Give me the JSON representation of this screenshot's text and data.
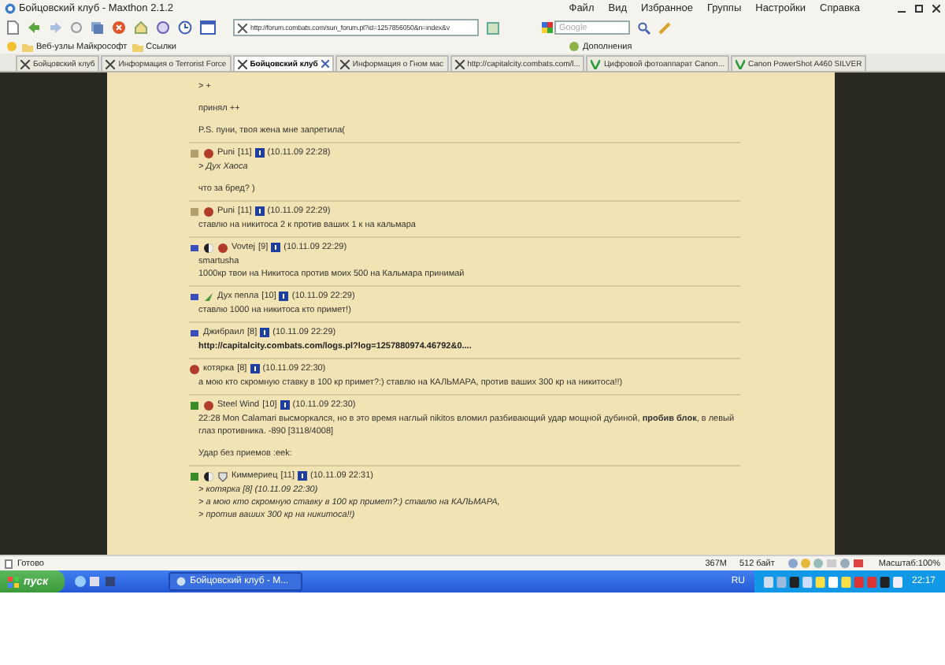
{
  "window": {
    "title": "Бойцовский клуб - Maxthon 2.1.2"
  },
  "menu": [
    "Файл",
    "Вид",
    "Избранное",
    "Группы",
    "Настройки",
    "Справка"
  ],
  "toolbar": {
    "address": "http://forum.combats.com/sun_forum.pl?id=1257856050&n=index&v",
    "search": {
      "placeholder": "Google"
    }
  },
  "links_bar": {
    "items": [
      "Веб-узлы Майкрософт",
      "Ссылки"
    ],
    "addons": "Дополнения"
  },
  "tabs": [
    {
      "label": "Бойцовский клуб",
      "selected": false
    },
    {
      "label": "Информация о Terrorist Force",
      "selected": false
    },
    {
      "label": "Бойцовский клуб",
      "selected": true
    },
    {
      "label": "Информация о Гном мас",
      "selected": false
    },
    {
      "label": "http://capitalcity.combats.com/l...",
      "selected": false
    },
    {
      "label": "Цифровой фотоаппарат Canon...",
      "selected": false
    },
    {
      "label": "Canon PowerShot A460 SILVER",
      "selected": false
    }
  ],
  "posts": [
    {
      "paragraphs": [
        [
          {
            "kind": "text",
            "text": "> +"
          }
        ],
        [
          {
            "kind": "text",
            "text": "принял ++"
          }
        ],
        [
          {
            "kind": "text",
            "text": "P.S. пуни, твоя жена мне запретила("
          }
        ]
      ]
    },
    {
      "author": "Puni",
      "level": "[11]",
      "time": "(10.11.09 22:28)",
      "icons": [
        {
          "kind": "badge"
        },
        {
          "kind": "orb"
        }
      ],
      "paragraphs": [
        [
          {
            "kind": "quote",
            "text": "> Дух Хаоса"
          }
        ],
        [
          {
            "kind": "text",
            "text": "что за бред? )"
          }
        ]
      ]
    },
    {
      "author": "Puni",
      "level": "[11]",
      "time": "(10.11.09 22:29)",
      "icons": [
        {
          "kind": "badge"
        },
        {
          "kind": "orb"
        }
      ],
      "paragraphs": [
        [
          {
            "kind": "text",
            "text": "ставлю на никитоса 2 к против ваших 1 к на кальмара"
          }
        ]
      ]
    },
    {
      "author": "Vovtej",
      "level": "[9]",
      "time": "(10.11.09 22:29)",
      "icons": [
        {
          "kind": "square"
        },
        {
          "kind": "yin"
        },
        {
          "kind": "orb"
        }
      ],
      "paragraphs": [
        [
          {
            "kind": "text",
            "text": "smartusha"
          },
          {
            "kind": "text",
            "text": "1000кр твои на Никитоса против моих 500 на Кальмара принимай"
          }
        ]
      ]
    },
    {
      "author": "Дух пепла",
      "level": "[10]",
      "time": "(10.11.09 22:29)",
      "icons": [
        {
          "kind": "square"
        },
        {
          "kind": "leaf"
        }
      ],
      "paragraphs": [
        [
          {
            "kind": "text",
            "text": "ставлю 1000 на никитоса кто примет!)"
          }
        ]
      ]
    },
    {
      "author": "Джибраил",
      "level": "[8]",
      "time": "(10.11.09 22:29)",
      "icons": [
        {
          "kind": "square"
        }
      ],
      "paragraphs": [
        [
          {
            "kind": "link",
            "text": "http://capitalcity.combats.com/logs.pl?log=1257880974.46792&0...."
          }
        ]
      ]
    },
    {
      "author": "котярка",
      "level": "[8]",
      "time": "(10.11.09 22:30)",
      "icons": [
        {
          "kind": "orb"
        }
      ],
      "paragraphs": [
        [
          {
            "kind": "text",
            "text": "а мою кто скромную ставку в 100 кр примет?:) ставлю на КАЛЬМАРА, против ваших 300 кр на никитоса!!)"
          }
        ]
      ]
    },
    {
      "author": "Steel Wind",
      "level": "[10]",
      "time": "(10.11.09 22:30)",
      "icons": [
        {
          "kind": "flag"
        },
        {
          "kind": "orb"
        }
      ],
      "paragraphs": [
        [
          {
            "kind": "text",
            "text": "22:28 Mon Calamari высморкался, но в это время наглый nikitos вломил разбивающий удар мощной дубиной, **пробив блок**, в левый глаз противника. -890 [3118/4008]"
          }
        ],
        [
          {
            "kind": "text",
            "text": "Удар без приемов :eek:"
          }
        ]
      ]
    },
    {
      "author": "Киммериец",
      "level": "[11]",
      "time": "(10.11.09 22:31)",
      "icons": [
        {
          "kind": "flag"
        },
        {
          "kind": "yin"
        },
        {
          "kind": "shield"
        }
      ],
      "paragraphs": [
        [
          {
            "kind": "quote",
            "text": "> котярка [8]   (10.11.09 22:30)"
          },
          {
            "kind": "quote",
            "text": "> а мою кто скромную ставку в 100 кр примет?:) ставлю на КАЛЬМАРА,"
          },
          {
            "kind": "quote",
            "text": "> против ваших 300 кр на никитоса!!)"
          }
        ]
      ]
    }
  ],
  "status_bar": {
    "text": "Готово",
    "memory": "367M",
    "size": "512 байт",
    "zoom": "Масштаб:100%"
  },
  "taskbar": {
    "start": "пуск",
    "task": "Бойцовский клуб - M...",
    "language": "RU",
    "clock": "22:17"
  }
}
